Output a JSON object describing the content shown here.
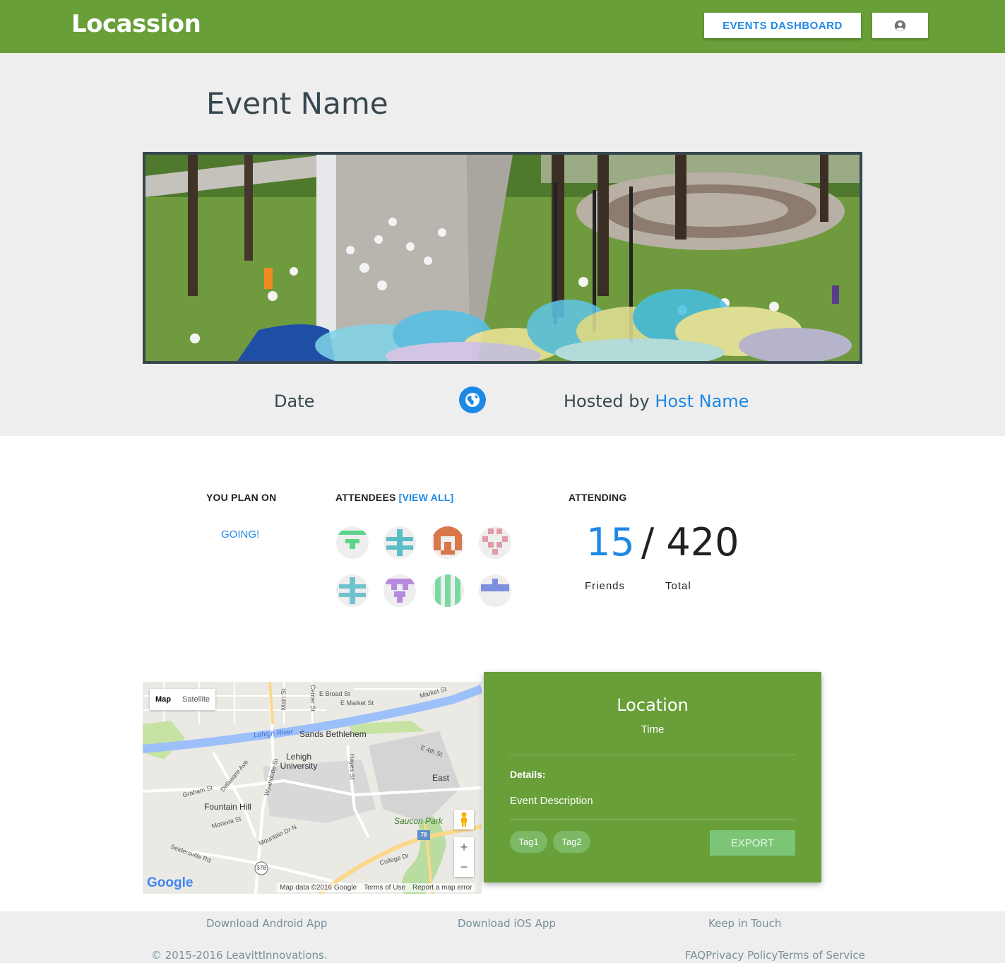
{
  "header": {
    "brand": "Locassion",
    "dashboard_label": "EVENTS DASHBOARD",
    "user_icon": "account-circle-icon"
  },
  "event": {
    "title": "Event Name",
    "date": "Date",
    "hosted_prefix": "Hosted by ",
    "host_name": "Host Name",
    "globe_icon": "globe-icon"
  },
  "stats": {
    "plan_label": "YOU PLAN ON",
    "plan_value": "GOING!",
    "attendees_label": "ATTENDEES ",
    "view_all": "[VIEW ALL]",
    "attending_label": "ATTENDING",
    "friends_count": "15",
    "total_count": "/ 420",
    "friends_label": "Friends",
    "total_label": "Total"
  },
  "attendees": [
    {
      "color": "#5ed48a"
    },
    {
      "color": "#5bbdc8"
    },
    {
      "color": "#d9764a"
    },
    {
      "color": "#e09aa8"
    },
    {
      "color": "#6fc3cf"
    },
    {
      "color": "#b78ae0"
    },
    {
      "color": "#7ad9a3"
    },
    {
      "color": "#7f8fe0"
    }
  ],
  "map": {
    "type_map": "Map",
    "type_satellite": "Satellite",
    "labels": [
      "Lehigh River",
      "Sands Bethlehem",
      "Lehigh University",
      "Fountain Hill",
      "Saucon Park",
      "E Broad St",
      "E Market St",
      "Market St",
      "E 4th St",
      "Main St",
      "Center St",
      "Hayes St",
      "Wyandotte St",
      "Delaware Ave",
      "Graham St",
      "Moravia St",
      "Mountain Dr N",
      "Seidersville Rd",
      "College Dr",
      "East"
    ],
    "google": "Google",
    "map_data": "Map data ©2016 Google",
    "terms": "Terms of Use",
    "report": "Report a map error",
    "zoom_in": "+",
    "zoom_out": "−",
    "route_378": "378",
    "route_78": "78"
  },
  "location": {
    "title": "Location",
    "time": "Time",
    "details_label": "Details:",
    "description": "Event Description",
    "tags": [
      "Tag1",
      "Tag2"
    ],
    "export_label": "EXPORT"
  },
  "footer": {
    "android": "Download Android App",
    "ios": "Download iOS App",
    "keep": "Keep in Touch",
    "copyright": "© 2015-2016 LeavittInnovations.",
    "faq": "FAQ",
    "privacy": "Privacy Policy",
    "terms": "Terms of Service"
  }
}
